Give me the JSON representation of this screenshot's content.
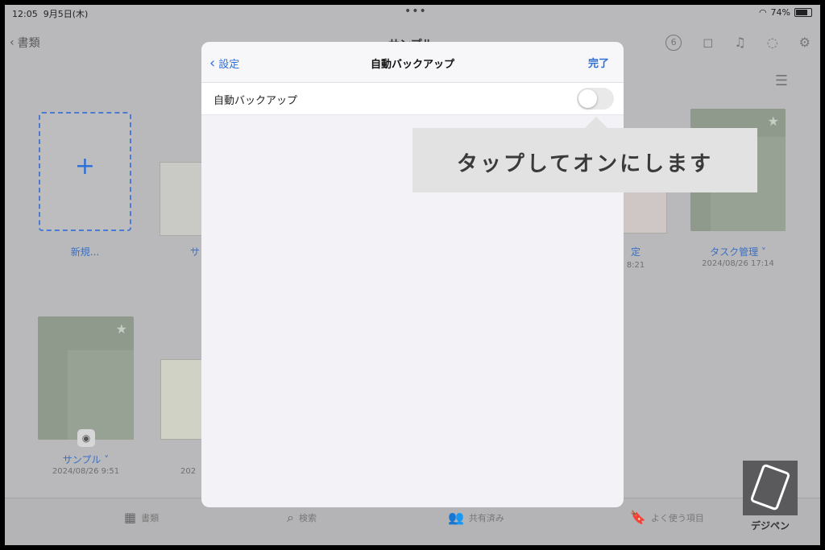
{
  "status": {
    "time": "12:05",
    "date": "9月5日(木)",
    "battery": "74%"
  },
  "nav": {
    "back_label": "書類",
    "title": "サンプル",
    "badge_count": "6"
  },
  "grid": {
    "new_label": "新規...",
    "item1_label": "サ",
    "item3_label": "定",
    "item3_date": "8:21",
    "task_label": "タスク管理",
    "task_date": "2024/08/26 17:14",
    "sample_label": "サンプル",
    "sample_date": "2024/08/26 9:51",
    "item5_date": "202"
  },
  "modal": {
    "back_label": "設定",
    "title": "自動バックアップ",
    "done_label": "完了",
    "row_label": "自動バックアップ",
    "toggle_on": false
  },
  "callout": {
    "text": "タップしてオンにします"
  },
  "tabs": [
    {
      "label": "書類",
      "icon": "grid-icon"
    },
    {
      "label": "検索",
      "icon": "search-icon"
    },
    {
      "label": "共有済み",
      "icon": "people-icon"
    },
    {
      "label": "よく使う項目",
      "icon": "bookmark-star-icon"
    }
  ],
  "logo": {
    "text": "デジペン"
  },
  "colors": {
    "accent": "#2f6fd6",
    "overlay": "#b9b9bb",
    "callout": "#e2e2e2"
  }
}
